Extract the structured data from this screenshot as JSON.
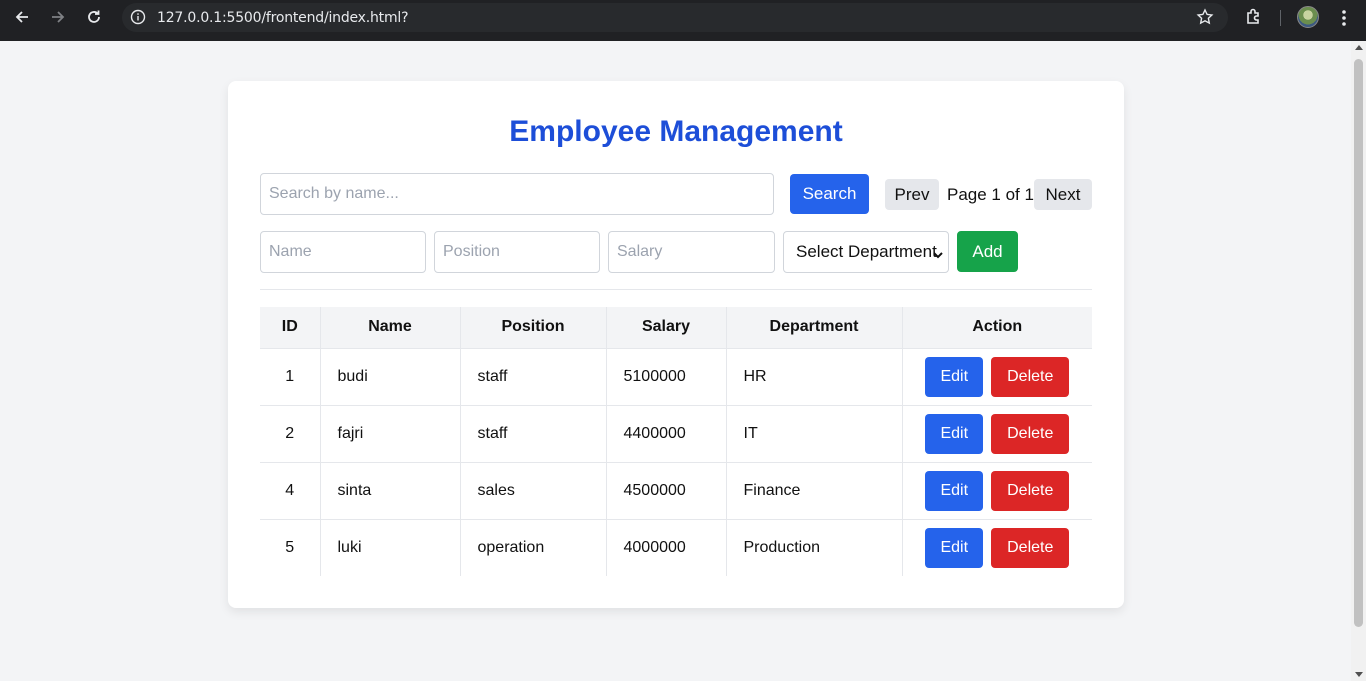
{
  "browser": {
    "url_main": "127.0.0.1",
    "url_rest": ":5500/frontend/index.html?"
  },
  "app": {
    "title": "Employee Management",
    "search": {
      "placeholder": "Search by name...",
      "value": "",
      "button_label": "Search"
    },
    "pagination": {
      "prev_label": "Prev",
      "page_text": "Page 1 of 1",
      "next_label": "Next"
    },
    "add_form": {
      "name_placeholder": "Name",
      "position_placeholder": "Position",
      "salary_placeholder": "Salary",
      "department_selected": "Select Department",
      "add_label": "Add"
    },
    "table": {
      "headers": [
        "ID",
        "Name",
        "Position",
        "Salary",
        "Department",
        "Action"
      ],
      "rows": [
        {
          "id": "1",
          "name": "budi",
          "position": "staff",
          "salary": "5100000",
          "department": "HR",
          "edit": "Edit",
          "delete": "Delete"
        },
        {
          "id": "2",
          "name": "fajri",
          "position": "staff",
          "salary": "4400000",
          "department": "IT",
          "edit": "Edit",
          "delete": "Delete"
        },
        {
          "id": "4",
          "name": "sinta",
          "position": "sales",
          "salary": "4500000",
          "department": "Finance",
          "edit": "Edit",
          "delete": "Delete"
        },
        {
          "id": "5",
          "name": "luki",
          "position": "operation",
          "salary": "4000000",
          "department": "Production",
          "edit": "Edit",
          "delete": "Delete"
        }
      ]
    }
  },
  "colors": {
    "title": "#1d4ed8",
    "primary": "#2563eb",
    "success": "#16a34a",
    "danger": "#dc2626"
  },
  "icons": [
    "back-arrow-icon",
    "forward-arrow-icon",
    "reload-icon",
    "site-info-icon",
    "bookmark-star-icon",
    "extensions-icon",
    "profile-avatar",
    "kebab-menu-icon",
    "chevron-down-icon"
  ]
}
